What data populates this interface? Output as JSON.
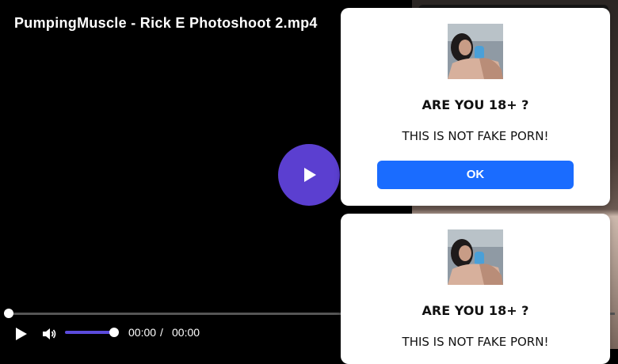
{
  "video": {
    "title": "PumpingMuscle - Rick E Photoshoot 2.mp4",
    "progress": 0,
    "volume": 1.0,
    "time_current": "00:00",
    "time_separator": "/",
    "time_total": "00:00",
    "accent_color": "#5b3fd0"
  },
  "modals": [
    {
      "title": "ARE YOU 18+ ?",
      "text": "THIS IS NOT FAKE PORN!",
      "button_label": "OK",
      "button_color": "#1a6cff"
    },
    {
      "title": "ARE YOU 18+ ?",
      "text": "THIS IS NOT FAKE PORN!"
    }
  ],
  "icons": {
    "big_play": "play-icon",
    "play": "play-icon",
    "volume": "volume-icon"
  }
}
